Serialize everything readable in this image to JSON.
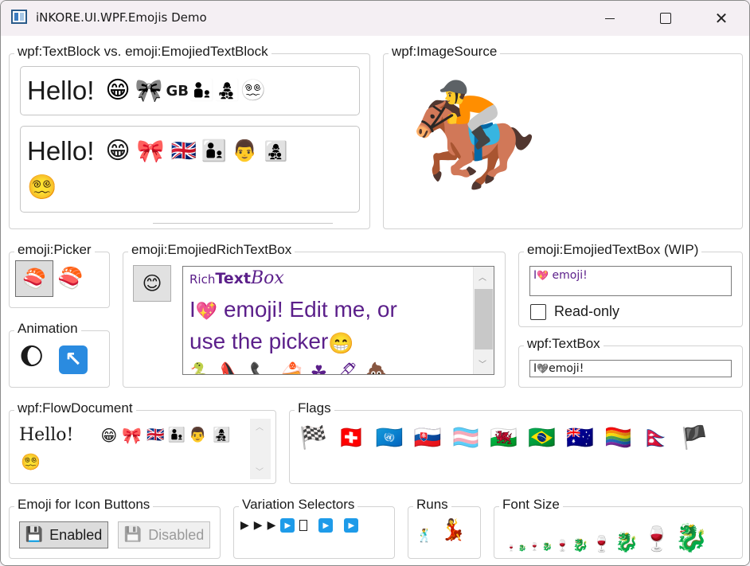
{
  "window": {
    "title": "iNKORE.UI.WPF.Emojis Demo"
  },
  "groups": {
    "textblock": "wpf:TextBlock vs. emoji:EmojiedTextBlock",
    "imagesource": "wpf:ImageSource",
    "picker": "emoji:Picker",
    "animation": "Animation",
    "richtextbox": "emoji:EmojiedRichTextBox",
    "emojitextbox": "emoji:EmojiedTextBox (WIP)",
    "textbox": "wpf:TextBox",
    "flowdocument": "wpf:FlowDocument",
    "flags": "Flags",
    "iconbuttons": "Emoji for Icon Buttons",
    "variation": "Variation Selectors",
    "runs": "Runs",
    "fontsize": "Font Size"
  },
  "textblock": {
    "plain_hello": "Hello!",
    "plain_gb": "GB",
    "emojied_hello": "Hello!"
  },
  "richtext": {
    "rich": "Rich",
    "text": "Text",
    "box": "Box",
    "line1": "I",
    "line1b": " emoji! Edit me, or",
    "line2": "use the picker"
  },
  "emojitextbox": {
    "value": "I  emoji!",
    "readonly_label": "Read-only"
  },
  "wpftextbox": {
    "value": "I  emoji!"
  },
  "flowdoc": {
    "hello": "Hello!"
  },
  "iconbuttons": {
    "enabled": "Enabled",
    "disabled": "Disabled"
  },
  "icons": {
    "grin": "😁",
    "bow": "🎀",
    "gbflag": "🇬🇧",
    "family1": "👨‍👦",
    "man": "👨",
    "family2": "👩‍👧‍👦",
    "dizzy": "😵‍💫",
    "horse": "🏇",
    "sushi": "🍣",
    "moon": "🌔",
    "arrow": "↖",
    "smile": "😊",
    "heart": "💖",
    "floppy": "💾",
    "play": "▶",
    "square": "⏹",
    "dancer_m": "🕺",
    "dancer_f": "💃",
    "wine": "🍷",
    "dragon": "🐉"
  },
  "rich_emoji_row": [
    "🐍",
    "👠",
    "📞",
    "🍰",
    "☘",
    "🖊",
    "💩"
  ],
  "flags": [
    "🏁",
    "🇨🇭",
    "🇺🇳",
    "🇸🇰",
    "🏳️‍⚧️",
    "🏴󠁧󠁢󠁷󠁬󠁳󠁿",
    "🇧🇷",
    "🇦🇺",
    "🏳️‍🌈",
    "🇳🇵",
    "🏴"
  ],
  "colors": {
    "accent_purple": "#5b1f8a",
    "scroll_thumb": "#c8c8c8",
    "button_bg": "#e1e1e1"
  }
}
